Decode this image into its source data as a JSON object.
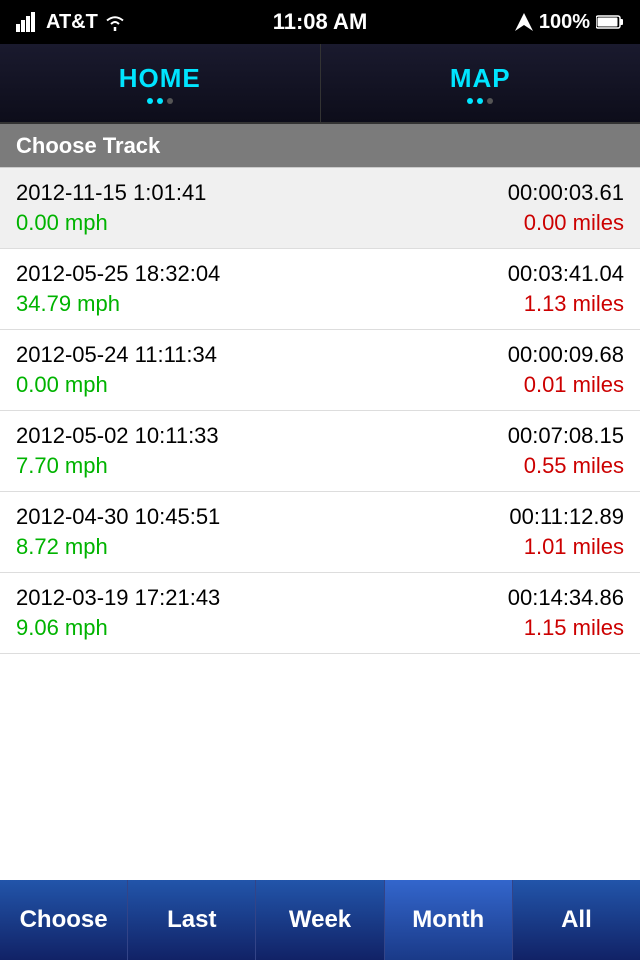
{
  "statusBar": {
    "carrier": "AT&T",
    "time": "11:08 AM",
    "battery": "100%"
  },
  "navTabs": [
    {
      "id": "home",
      "label": "HOME",
      "active": true
    },
    {
      "id": "map",
      "label": "MAP",
      "active": false
    }
  ],
  "chooseTrackHeader": "Choose Track",
  "tracks": [
    {
      "date": "2012-11-15 1:01:41",
      "duration": "00:00:03.61",
      "speed": "0.00 mph",
      "distance": "0.00 miles"
    },
    {
      "date": "2012-05-25 18:32:04",
      "duration": "00:03:41.04",
      "speed": "34.79 mph",
      "distance": "1.13 miles"
    },
    {
      "date": "2012-05-24 11:11:34",
      "duration": "00:00:09.68",
      "speed": "0.00 mph",
      "distance": "0.01 miles"
    },
    {
      "date": "2012-05-02 10:11:33",
      "duration": "00:07:08.15",
      "speed": "7.70 mph",
      "distance": "0.55 miles"
    },
    {
      "date": "2012-04-30 10:45:51",
      "duration": "00:11:12.89",
      "speed": "8.72 mph",
      "distance": "1.01 miles"
    },
    {
      "date": "2012-03-19 17:21:43",
      "duration": "00:14:34.86",
      "speed": "9.06 mph",
      "distance": "1.15 miles"
    }
  ],
  "bottomTabs": [
    {
      "id": "choose",
      "label": "Choose",
      "active": false
    },
    {
      "id": "last",
      "label": "Last",
      "active": false
    },
    {
      "id": "week",
      "label": "Week",
      "active": false
    },
    {
      "id": "month",
      "label": "Month",
      "active": true
    },
    {
      "id": "all",
      "label": "All",
      "active": false
    }
  ]
}
